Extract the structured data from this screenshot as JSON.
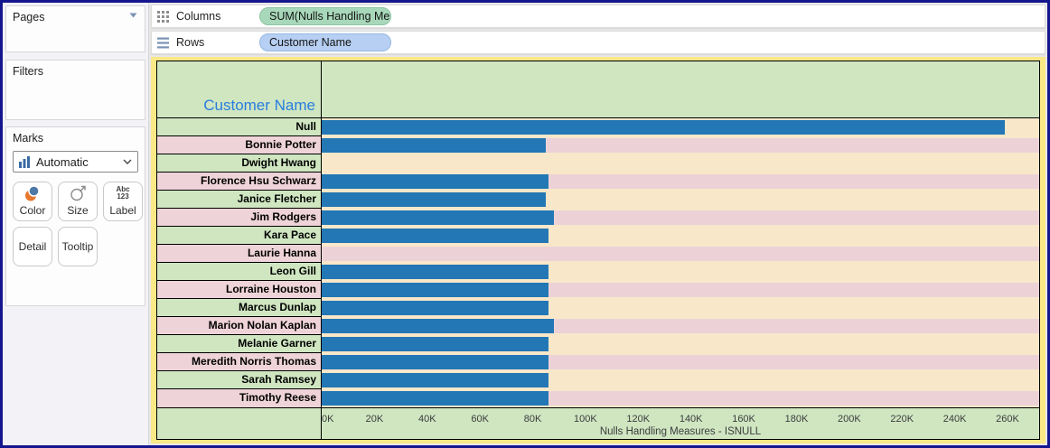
{
  "colors": {
    "window_border": "#15158e",
    "canvas_yellow": "#fbe886",
    "header_green": "#cfe6c1",
    "label_pink": "#eed3d8",
    "band_pink": "#ecd2d7",
    "band_tan": "#f9e7ca",
    "bar_blue": "#2277b4",
    "header_text_blue": "#2a7dde",
    "pill_green": "#a8d8ba",
    "pill_blue": "#b6cff2"
  },
  "sidebar": {
    "pages": {
      "label": "Pages"
    },
    "filters": {
      "label": "Filters"
    },
    "marks": {
      "label": "Marks",
      "mark_type": "Automatic",
      "buttons": [
        "Color",
        "Size",
        "Label",
        "Detail",
        "Tooltip"
      ],
      "label_icon_line1": "Abc",
      "label_icon_line2": "123"
    }
  },
  "shelves": {
    "columns": {
      "label": "Columns",
      "pill": "SUM(Nulls Handling Me.."
    },
    "rows": {
      "label": "Rows",
      "pill": "Customer Name"
    }
  },
  "chart_data": {
    "type": "bar",
    "orientation": "horizontal",
    "row_header": "Customer Name",
    "categories": [
      "Null",
      "Bonnie Potter",
      "Dwight Hwang",
      "Florence Hsu Schwarz",
      "Janice Fletcher",
      "Jim Rodgers",
      "Kara Pace",
      "Laurie Hanna",
      "Leon Gill",
      "Lorraine Houston",
      "Marcus Dunlap",
      "Marion Nolan Kaplan",
      "Melanie Garner",
      "Meredith Norris Thomas",
      "Sarah Ramsey",
      "Timothy Reese"
    ],
    "values": [
      259000,
      85000,
      0,
      86000,
      85000,
      88000,
      86000,
      0,
      86000,
      86000,
      86000,
      88000,
      86000,
      86000,
      86000,
      86000
    ],
    "xlabel": "Nulls Handling Measures - ISNULL",
    "x_ticks": [
      {
        "value": 0,
        "label": "0K"
      },
      {
        "value": 20000,
        "label": "20K"
      },
      {
        "value": 40000,
        "label": "40K"
      },
      {
        "value": 60000,
        "label": "60K"
      },
      {
        "value": 80000,
        "label": "80K"
      },
      {
        "value": 100000,
        "label": "100K"
      },
      {
        "value": 120000,
        "label": "120K"
      },
      {
        "value": 140000,
        "label": "140K"
      },
      {
        "value": 160000,
        "label": "160K"
      },
      {
        "value": 180000,
        "label": "180K"
      },
      {
        "value": 200000,
        "label": "200K"
      },
      {
        "value": 220000,
        "label": "220K"
      },
      {
        "value": 240000,
        "label": "240K"
      },
      {
        "value": 260000,
        "label": "260K"
      }
    ],
    "xlim": [
      0,
      272000
    ],
    "grid": false,
    "legend": false,
    "bar_color": "#2277b4"
  }
}
